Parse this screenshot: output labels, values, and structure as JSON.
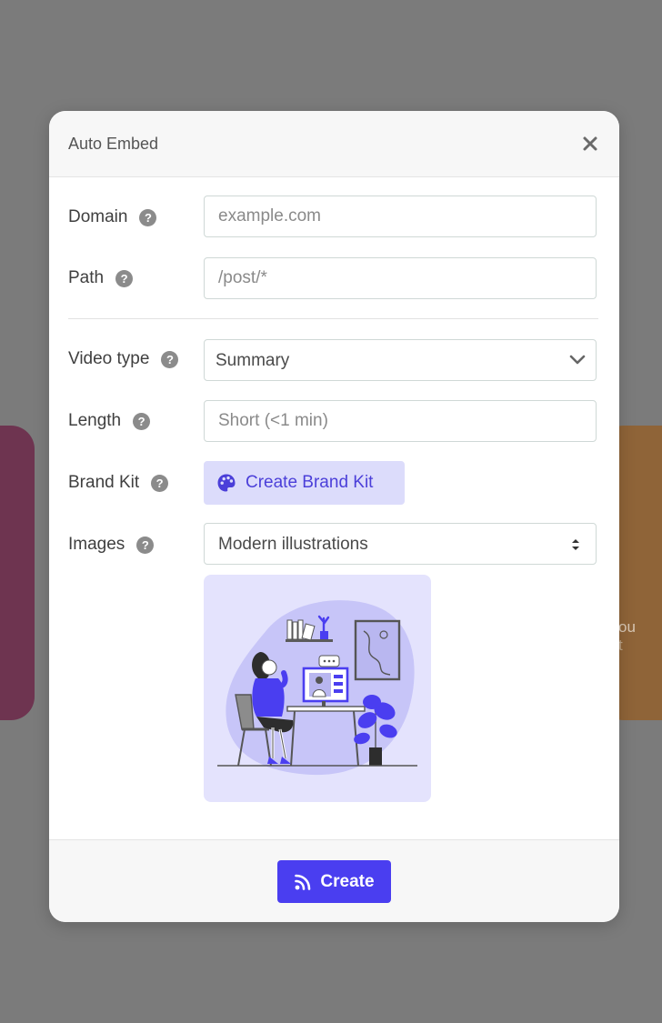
{
  "background": {
    "right_card_text_1": "ou",
    "right_card_text_2": "t"
  },
  "modal": {
    "title": "Auto Embed",
    "close_icon": "close-icon"
  },
  "form": {
    "domain": {
      "label": "Domain",
      "placeholder": "example.com",
      "value": ""
    },
    "path": {
      "label": "Path",
      "placeholder": "/post/*",
      "value": ""
    },
    "video_type": {
      "label": "Video type",
      "selected": "Summary"
    },
    "length": {
      "label": "Length",
      "placeholder": "Short (<1 min)",
      "value": ""
    },
    "brand_kit": {
      "label": "Brand Kit",
      "button_label": "Create Brand Kit",
      "icon": "palette-icon"
    },
    "images": {
      "label": "Images",
      "selected": "Modern illustrations"
    },
    "help_glyph": "?"
  },
  "footer": {
    "create_label": "Create",
    "create_icon": "rss-icon"
  },
  "colors": {
    "accent": "#4a3ef0",
    "accent_light": "#dcdcfb",
    "preview_bg": "#e4e3fd"
  }
}
